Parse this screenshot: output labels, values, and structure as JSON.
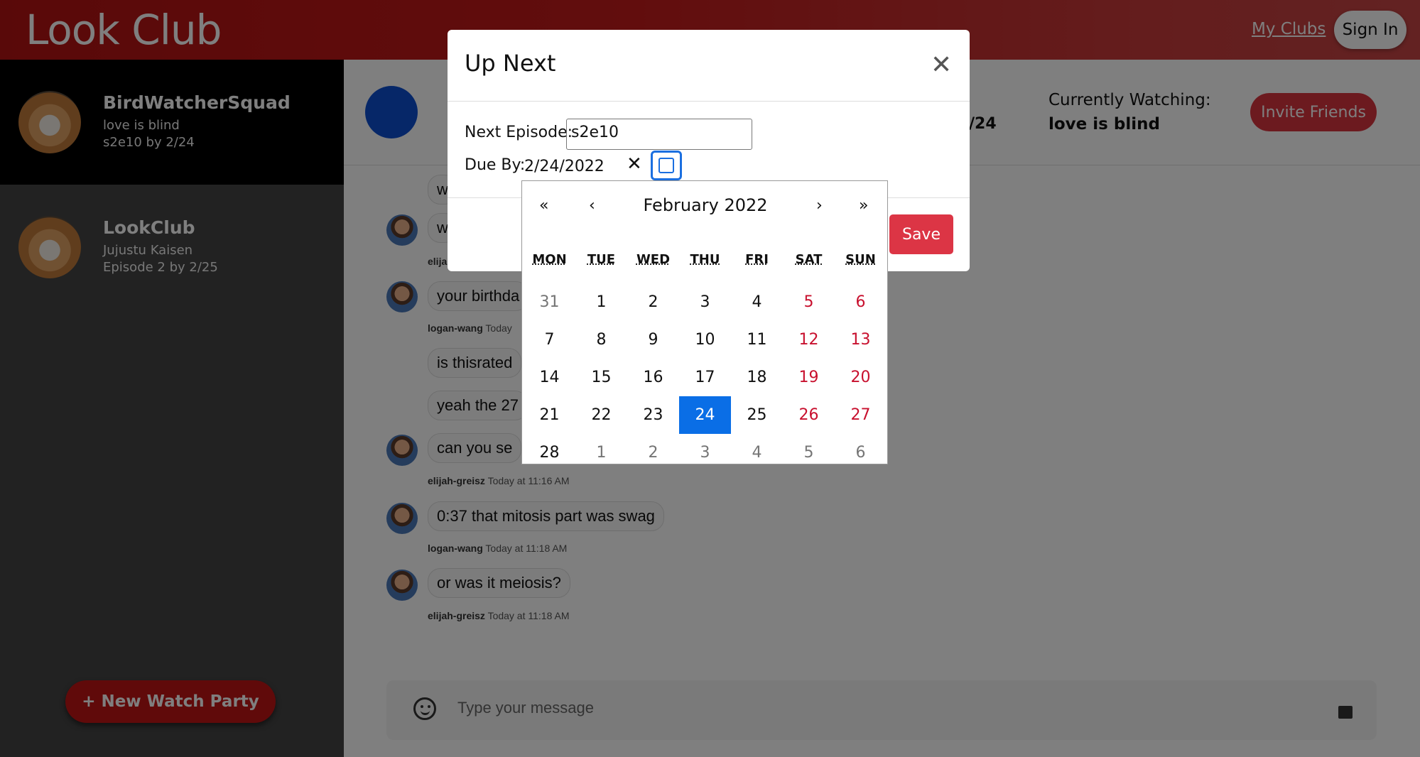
{
  "header": {
    "logo": "Look Club",
    "my_clubs": "My Clubs",
    "sign_in": "Sign In"
  },
  "sidebar": {
    "clubs": [
      {
        "name": "BirdWatcherSquad",
        "show": "love is blind",
        "progress": "s2e10 by 2/24"
      },
      {
        "name": "LookClub",
        "show": "Jujustu Kaisen",
        "progress": "Episode 2 by 2/25"
      }
    ],
    "new_party": "+ New Watch Party"
  },
  "main_header": {
    "date_fragment": "/24",
    "currently_watching_label": "Currently Watching:",
    "currently_watching_value": "love is blind",
    "invite": "Invite Friends"
  },
  "messages": [
    {
      "text": "w"
    },
    {
      "text": "w",
      "meta_user": "elija"
    },
    {
      "text": "your birthda",
      "meta_user": "logan-wang",
      "meta_time": "Today"
    },
    {
      "text": "is thisrated"
    },
    {
      "text": "yeah the 27"
    },
    {
      "text": "can you se",
      "meta_user": "elijah-greisz",
      "meta_time": "Today at 11:16 AM"
    },
    {
      "text": "0:37 that mitosis part was swag",
      "meta_user": "logan-wang",
      "meta_time": "Today at 11:18 AM"
    },
    {
      "text": "or was it meiosis?",
      "meta_user": "elijah-greisz",
      "meta_time": "Today at 11:18 AM"
    }
  ],
  "composer": {
    "placeholder": "Type your message"
  },
  "modal": {
    "title": "Up Next",
    "next_episode_label": "Next Episode:",
    "next_episode_value": "s2e10",
    "due_by_label": "Due By:",
    "due_by_value": "2/24/2022",
    "save": "Save"
  },
  "calendar": {
    "month_label": "February 2022",
    "nav": {
      "prev_year": "«",
      "prev_month": "‹",
      "next_month": "›",
      "next_year": "»"
    },
    "weekdays": [
      "MON",
      "TUE",
      "WED",
      "THU",
      "FRI",
      "SAT",
      "SUN"
    ],
    "weeks": [
      [
        "31",
        "1",
        "2",
        "3",
        "4",
        "5",
        "6"
      ],
      [
        "7",
        "8",
        "9",
        "10",
        "11",
        "12",
        "13"
      ],
      [
        "14",
        "15",
        "16",
        "17",
        "18",
        "19",
        "20"
      ],
      [
        "21",
        "22",
        "23",
        "24",
        "25",
        "26",
        "27"
      ],
      [
        "28",
        "1",
        "2",
        "3",
        "4",
        "5",
        "6"
      ]
    ],
    "selected_day": "24",
    "colors": {
      "selected": "#0a6ee6",
      "weekend": "#c8102e",
      "other_month": "#757575"
    }
  }
}
